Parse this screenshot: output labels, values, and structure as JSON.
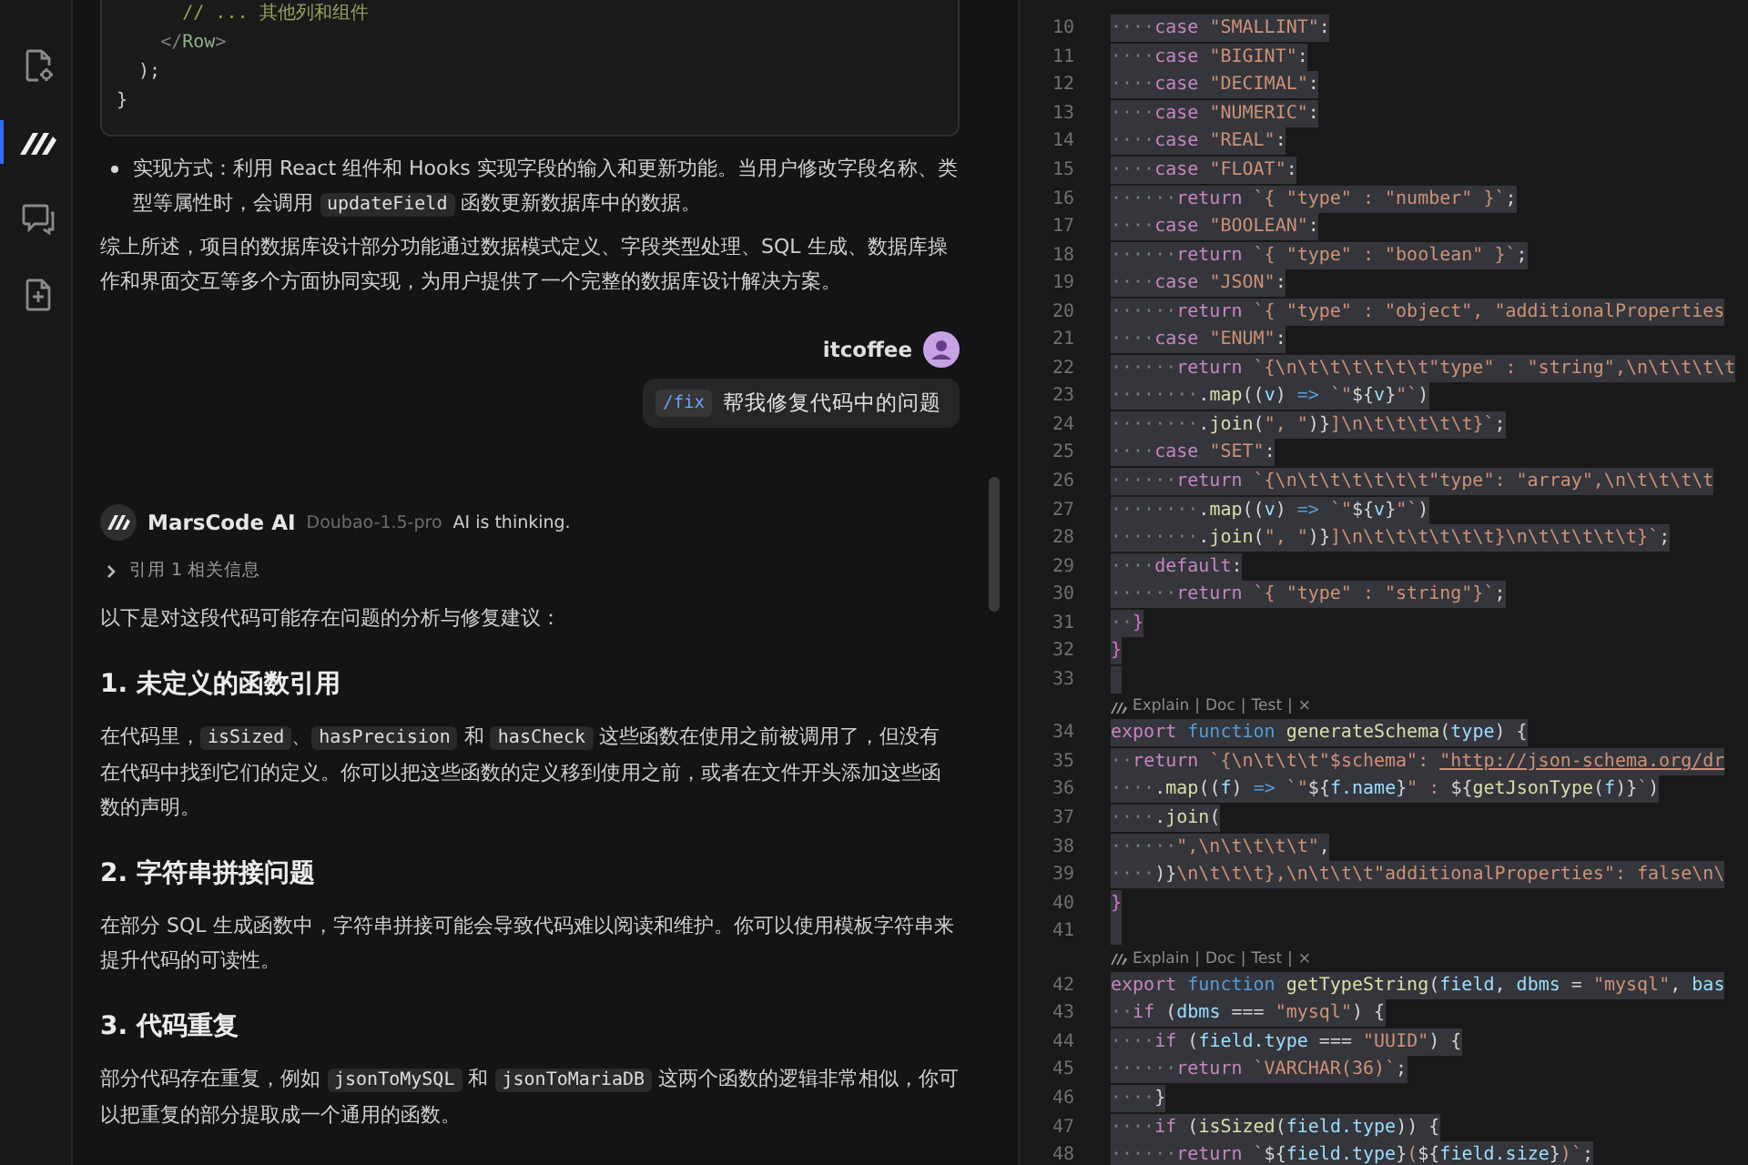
{
  "activity_bar": {
    "items": [
      {
        "kind": "file-settings",
        "selected": false
      },
      {
        "kind": "logo",
        "selected": true
      },
      {
        "kind": "chat",
        "selected": false
      },
      {
        "kind": "file-plus",
        "selected": false
      }
    ]
  },
  "chat": {
    "blocks": [
      {
        "kind": "code",
        "lines": [
          [
            {
              "kind": "comment",
              "text": "      // ... 其他列和组件"
            }
          ],
          [
            {
              "kind": "punct",
              "text": "    </"
            },
            {
              "kind": "tag",
              "text": "Row"
            },
            {
              "kind": "punct",
              "text": ">"
            }
          ],
          [
            {
              "kind": "plain",
              "text": "  );"
            }
          ],
          [
            {
              "kind": "plain",
              "text": "}"
            }
          ]
        ]
      },
      {
        "kind": "bullet",
        "segments": [
          {
            "kind": "text",
            "text": "实现方式：利用 React 组件和 Hooks 实现字段的输入和更新功能。当用户修改字段名称、类型等属性时，会调用 "
          },
          {
            "kind": "code",
            "text": "updateField"
          },
          {
            "kind": "text",
            "text": " 函数更新数据库中的数据。"
          }
        ]
      },
      {
        "kind": "paragraph",
        "segments": [
          {
            "kind": "text",
            "text": "综上所述，项目的数据库设计部分功能通过数据模式定义、字段类型处理、SQL 生成、数据库操作和界面交互等多个方面协同实现，为用户提供了一个完整的数据库设计解决方案。"
          }
        ]
      },
      {
        "kind": "user",
        "name": "itcoffee",
        "command": "/fix",
        "text": "帮我修复代码中的问题"
      },
      {
        "kind": "ai",
        "name": "MarsCode AI",
        "model": "Doubao-1.5-pro",
        "status": "AI is thinking."
      },
      {
        "kind": "reference",
        "text": "引用 1 相关信息",
        "expanded": false
      },
      {
        "kind": "paragraph",
        "segments": [
          {
            "kind": "text",
            "text": "以下是对这段代码可能存在问题的分析与修复建议："
          }
        ]
      },
      {
        "kind": "heading",
        "text": "1. 未定义的函数引用"
      },
      {
        "kind": "paragraph",
        "segments": [
          {
            "kind": "text",
            "text": "在代码里，"
          },
          {
            "kind": "code",
            "text": "isSized"
          },
          {
            "kind": "text",
            "text": "、"
          },
          {
            "kind": "code",
            "text": "hasPrecision"
          },
          {
            "kind": "text",
            "text": " 和 "
          },
          {
            "kind": "code",
            "text": "hasCheck"
          },
          {
            "kind": "text",
            "text": " 这些函数在使用之前被调用了，但没有在代码中找到它们的定义。你可以把这些函数的定义移到使用之前，或者在文件开头添加这些函数的声明。"
          }
        ]
      },
      {
        "kind": "heading",
        "text": "2. 字符串拼接问题"
      },
      {
        "kind": "paragraph",
        "segments": [
          {
            "kind": "text",
            "text": "在部分 SQL 生成函数中，字符串拼接可能会导致代码难以阅读和维护。你可以使用模板字符串来提升代码的可读性。"
          }
        ]
      },
      {
        "kind": "heading",
        "text": "3. 代码重复"
      },
      {
        "kind": "paragraph",
        "segments": [
          {
            "kind": "text",
            "text": "部分代码存在重复，例如 "
          },
          {
            "kind": "code",
            "text": "jsonToMySQL"
          },
          {
            "kind": "text",
            "text": " 和 "
          },
          {
            "kind": "code",
            "text": "jsonToMariaDB"
          },
          {
            "kind": "text",
            "text": " 这两个函数的逻辑非常相似，你可以把重复的部分提取成一个通用的函数。"
          }
        ]
      }
    ]
  },
  "editor": {
    "selected": true,
    "items": [
      {
        "kind": "line",
        "number": "10",
        "indent": "····",
        "tokens": [
          {
            "kind": "keyword",
            "text": "case"
          },
          {
            "kind": "string",
            "text": " \"SMALLINT\""
          },
          {
            "kind": "plain",
            "text": ":"
          }
        ]
      },
      {
        "kind": "line",
        "number": "11",
        "indent": "····",
        "tokens": [
          {
            "kind": "keyword",
            "text": "case"
          },
          {
            "kind": "string",
            "text": " \"BIGINT\""
          },
          {
            "kind": "plain",
            "text": ":"
          }
        ]
      },
      {
        "kind": "line",
        "number": "12",
        "indent": "····",
        "tokens": [
          {
            "kind": "keyword",
            "text": "case"
          },
          {
            "kind": "string",
            "text": " \"DECIMAL\""
          },
          {
            "kind": "plain",
            "text": ":"
          }
        ]
      },
      {
        "kind": "line",
        "number": "13",
        "indent": "····",
        "tokens": [
          {
            "kind": "keyword",
            "text": "case"
          },
          {
            "kind": "string",
            "text": " \"NUMERIC\""
          },
          {
            "kind": "plain",
            "text": ":"
          }
        ]
      },
      {
        "kind": "line",
        "number": "14",
        "indent": "····",
        "tokens": [
          {
            "kind": "keyword",
            "text": "case"
          },
          {
            "kind": "string",
            "text": " \"REAL\""
          },
          {
            "kind": "plain",
            "text": ":"
          }
        ]
      },
      {
        "kind": "line",
        "number": "15",
        "indent": "····",
        "tokens": [
          {
            "kind": "keyword",
            "text": "case"
          },
          {
            "kind": "string",
            "text": " \"FLOAT\""
          },
          {
            "kind": "plain",
            "text": ":"
          }
        ]
      },
      {
        "kind": "line",
        "number": "16",
        "indent": "······",
        "tokens": [
          {
            "kind": "keyword",
            "text": "return"
          },
          {
            "kind": "string",
            "text": " `{ \"type\" : \"number\" }`"
          },
          {
            "kind": "plain",
            "text": ";"
          }
        ]
      },
      {
        "kind": "line",
        "number": "17",
        "indent": "····",
        "tokens": [
          {
            "kind": "keyword",
            "text": "case"
          },
          {
            "kind": "string",
            "text": " \"BOOLEAN\""
          },
          {
            "kind": "plain",
            "text": ":"
          }
        ]
      },
      {
        "kind": "line",
        "number": "18",
        "indent": "······",
        "tokens": [
          {
            "kind": "keyword",
            "text": "return"
          },
          {
            "kind": "string",
            "text": " `{ \"type\" : \"boolean\" }`"
          },
          {
            "kind": "plain",
            "text": ";"
          }
        ]
      },
      {
        "kind": "line",
        "number": "19",
        "indent": "····",
        "tokens": [
          {
            "kind": "keyword",
            "text": "case"
          },
          {
            "kind": "string",
            "text": " \"JSON\""
          },
          {
            "kind": "plain",
            "text": ":"
          }
        ]
      },
      {
        "kind": "line",
        "number": "20",
        "indent": "······",
        "tokens": [
          {
            "kind": "keyword",
            "text": "return"
          },
          {
            "kind": "string",
            "text": " `{ \"type\" : \"object\", \"additionalProperties"
          }
        ]
      },
      {
        "kind": "line",
        "number": "21",
        "indent": "····",
        "tokens": [
          {
            "kind": "keyword",
            "text": "case"
          },
          {
            "kind": "string",
            "text": " \"ENUM\""
          },
          {
            "kind": "plain",
            "text": ":"
          }
        ]
      },
      {
        "kind": "line",
        "number": "22",
        "indent": "······",
        "tokens": [
          {
            "kind": "keyword",
            "text": "return"
          },
          {
            "kind": "string",
            "text": " `{\\n\\t\\t\\t\\t\\t\\t\"type\" : \"string\",\\n\\t\\t\\t\\t"
          }
        ]
      },
      {
        "kind": "line",
        "number": "23",
        "indent": "········",
        "tokens": [
          {
            "kind": "plain",
            "text": "."
          },
          {
            "kind": "function",
            "text": "map"
          },
          {
            "kind": "plain",
            "text": "(("
          },
          {
            "kind": "variable",
            "text": "v"
          },
          {
            "kind": "plain",
            "text": ") "
          },
          {
            "kind": "storage",
            "text": "=>"
          },
          {
            "kind": "string",
            "text": " `\""
          },
          {
            "kind": "plain",
            "text": "${"
          },
          {
            "kind": "variable",
            "text": "v"
          },
          {
            "kind": "plain",
            "text": "}"
          },
          {
            "kind": "string",
            "text": "\"`"
          },
          {
            "kind": "plain",
            "text": ")"
          }
        ]
      },
      {
        "kind": "line",
        "number": "24",
        "indent": "········",
        "tokens": [
          {
            "kind": "plain",
            "text": "."
          },
          {
            "kind": "function",
            "text": "join"
          },
          {
            "kind": "plain",
            "text": "("
          },
          {
            "kind": "string",
            "text": "\", \""
          },
          {
            "kind": "plain",
            "text": ")}"
          },
          {
            "kind": "string",
            "text": "]\\n\\t\\t\\t\\t\\t}`"
          },
          {
            "kind": "plain",
            "text": ";"
          }
        ]
      },
      {
        "kind": "line",
        "number": "25",
        "indent": "····",
        "tokens": [
          {
            "kind": "keyword",
            "text": "case"
          },
          {
            "kind": "string",
            "text": " \"SET\""
          },
          {
            "kind": "plain",
            "text": ":"
          }
        ]
      },
      {
        "kind": "line",
        "number": "26",
        "indent": "······",
        "tokens": [
          {
            "kind": "keyword",
            "text": "return"
          },
          {
            "kind": "string",
            "text": " `{\\n\\t\\t\\t\\t\\t\\t\"type\": \"array\",\\n\\t\\t\\t\\t"
          }
        ]
      },
      {
        "kind": "line",
        "number": "27",
        "indent": "········",
        "tokens": [
          {
            "kind": "plain",
            "text": "."
          },
          {
            "kind": "function",
            "text": "map"
          },
          {
            "kind": "plain",
            "text": "(("
          },
          {
            "kind": "variable",
            "text": "v"
          },
          {
            "kind": "plain",
            "text": ") "
          },
          {
            "kind": "storage",
            "text": "=>"
          },
          {
            "kind": "string",
            "text": " `\""
          },
          {
            "kind": "plain",
            "text": "${"
          },
          {
            "kind": "variable",
            "text": "v"
          },
          {
            "kind": "plain",
            "text": "}"
          },
          {
            "kind": "string",
            "text": "\"`"
          },
          {
            "kind": "plain",
            "text": ")"
          }
        ]
      },
      {
        "kind": "line",
        "number": "28",
        "indent": "········",
        "tokens": [
          {
            "kind": "plain",
            "text": "."
          },
          {
            "kind": "function",
            "text": "join"
          },
          {
            "kind": "plain",
            "text": "("
          },
          {
            "kind": "string",
            "text": "\", \""
          },
          {
            "kind": "plain",
            "text": ")}"
          },
          {
            "kind": "string",
            "text": "]\\n\\t\\t\\t\\t\\t\\t}\\n\\t\\t\\t\\t\\t}`"
          },
          {
            "kind": "plain",
            "text": ";"
          }
        ]
      },
      {
        "kind": "line",
        "number": "29",
        "indent": "····",
        "tokens": [
          {
            "kind": "keyword",
            "text": "default"
          },
          {
            "kind": "plain",
            "text": ":"
          }
        ]
      },
      {
        "kind": "line",
        "number": "30",
        "indent": "······",
        "tokens": [
          {
            "kind": "keyword",
            "text": "return"
          },
          {
            "kind": "string",
            "text": " `{ \"type\" : \"string\"}`"
          },
          {
            "kind": "plain",
            "text": ";"
          }
        ]
      },
      {
        "kind": "line",
        "number": "31",
        "indent": "··",
        "tokens": [
          {
            "kind": "bracket",
            "text": "}"
          }
        ]
      },
      {
        "kind": "line",
        "number": "32",
        "tokens": [
          {
            "kind": "bracket",
            "text": "}"
          }
        ]
      },
      {
        "kind": "line",
        "number": "33"
      },
      {
        "kind": "codelens",
        "actions": [
          "Explain",
          "Doc",
          "Test",
          "×"
        ],
        "separator": "|"
      },
      {
        "kind": "line",
        "number": "34",
        "tokens": [
          {
            "kind": "keyword",
            "text": "export"
          },
          {
            "kind": "storage",
            "text": " function"
          },
          {
            "kind": "function",
            "text": " generateSchema"
          },
          {
            "kind": "plain",
            "text": "("
          },
          {
            "kind": "variable",
            "text": "type"
          },
          {
            "kind": "plain",
            "text": ") {"
          }
        ]
      },
      {
        "kind": "line",
        "number": "35",
        "indent": "··",
        "tokens": [
          {
            "kind": "keyword",
            "text": "return"
          },
          {
            "kind": "string",
            "text": " `{\\n\\t\\t\\t\"$schema\": "
          },
          {
            "kind": "link",
            "text": "\"http://json-schema.org/dr"
          }
        ]
      },
      {
        "kind": "line",
        "number": "36",
        "indent": "····",
        "tokens": [
          {
            "kind": "plain",
            "text": "."
          },
          {
            "kind": "function",
            "text": "map"
          },
          {
            "kind": "plain",
            "text": "(("
          },
          {
            "kind": "variable",
            "text": "f"
          },
          {
            "kind": "plain",
            "text": ") "
          },
          {
            "kind": "storage",
            "text": "=>"
          },
          {
            "kind": "string",
            "text": " `\""
          },
          {
            "kind": "plain",
            "text": "${"
          },
          {
            "kind": "variable",
            "text": "f.name"
          },
          {
            "kind": "plain",
            "text": "}"
          },
          {
            "kind": "string",
            "text": "\" : "
          },
          {
            "kind": "plain",
            "text": "${"
          },
          {
            "kind": "function",
            "text": "getJsonType"
          },
          {
            "kind": "plain",
            "text": "("
          },
          {
            "kind": "variable",
            "text": "f"
          },
          {
            "kind": "plain",
            "text": ")}"
          },
          {
            "kind": "string",
            "text": "`"
          },
          {
            "kind": "plain",
            "text": ")"
          }
        ]
      },
      {
        "kind": "line",
        "number": "37",
        "indent": "····",
        "tokens": [
          {
            "kind": "plain",
            "text": "."
          },
          {
            "kind": "function",
            "text": "join"
          },
          {
            "kind": "plain",
            "text": "("
          }
        ]
      },
      {
        "kind": "line",
        "number": "38",
        "indent": "······",
        "tokens": [
          {
            "kind": "string",
            "text": "\",\\n\\t\\t\\t\\t\""
          },
          {
            "kind": "plain",
            "text": ","
          }
        ]
      },
      {
        "kind": "line",
        "number": "39",
        "indent": "····",
        "tokens": [
          {
            "kind": "plain",
            "text": ")}"
          },
          {
            "kind": "string",
            "text": "\\n\\t\\t\\t},\\n\\t\\t\\t\"additionalProperties\": false\\n\\"
          }
        ]
      },
      {
        "kind": "line",
        "number": "40",
        "tokens": [
          {
            "kind": "bracket",
            "text": "}"
          }
        ]
      },
      {
        "kind": "line",
        "number": "41"
      },
      {
        "kind": "codelens",
        "actions": [
          "Explain",
          "Doc",
          "Test",
          "×"
        ],
        "separator": "|"
      },
      {
        "kind": "line",
        "number": "42",
        "tokens": [
          {
            "kind": "keyword",
            "text": "export"
          },
          {
            "kind": "storage",
            "text": " function"
          },
          {
            "kind": "function",
            "text": " getTypeString"
          },
          {
            "kind": "plain",
            "text": "("
          },
          {
            "kind": "variable",
            "text": "field"
          },
          {
            "kind": "plain",
            "text": ", "
          },
          {
            "kind": "variable",
            "text": "dbms"
          },
          {
            "kind": "plain",
            "text": " = "
          },
          {
            "kind": "string",
            "text": "\"mysql\""
          },
          {
            "kind": "plain",
            "text": ", "
          },
          {
            "kind": "variable",
            "text": "bas"
          }
        ]
      },
      {
        "kind": "line",
        "number": "43",
        "indent": "··",
        "tokens": [
          {
            "kind": "keyword",
            "text": "if"
          },
          {
            "kind": "plain",
            "text": " ("
          },
          {
            "kind": "variable",
            "text": "dbms"
          },
          {
            "kind": "plain",
            "text": " === "
          },
          {
            "kind": "string",
            "text": "\"mysql\""
          },
          {
            "kind": "plain",
            "text": ") {"
          }
        ]
      },
      {
        "kind": "line",
        "number": "44",
        "indent": "····",
        "tokens": [
          {
            "kind": "keyword",
            "text": "if"
          },
          {
            "kind": "plain",
            "text": " ("
          },
          {
            "kind": "variable",
            "text": "field.type"
          },
          {
            "kind": "plain",
            "text": " === "
          },
          {
            "kind": "string",
            "text": "\"UUID\""
          },
          {
            "kind": "plain",
            "text": ") {"
          }
        ]
      },
      {
        "kind": "line",
        "number": "45",
        "indent": "······",
        "tokens": [
          {
            "kind": "keyword",
            "text": "return"
          },
          {
            "kind": "string",
            "text": " `VARCHAR(36)`"
          },
          {
            "kind": "plain",
            "text": ";"
          }
        ]
      },
      {
        "kind": "line",
        "number": "46",
        "indent": "····",
        "tokens": [
          {
            "kind": "plain",
            "text": "}"
          }
        ]
      },
      {
        "kind": "line",
        "number": "47",
        "indent": "····",
        "tokens": [
          {
            "kind": "keyword",
            "text": "if"
          },
          {
            "kind": "plain",
            "text": " ("
          },
          {
            "kind": "function",
            "text": "isSized"
          },
          {
            "kind": "plain",
            "text": "("
          },
          {
            "kind": "variable",
            "text": "field.type"
          },
          {
            "kind": "plain",
            "text": ")) {"
          }
        ]
      },
      {
        "kind": "line",
        "number": "48",
        "indent": "······",
        "tokens": [
          {
            "kind": "keyword",
            "text": "return"
          },
          {
            "kind": "string",
            "text": " `"
          },
          {
            "kind": "plain",
            "text": "${"
          },
          {
            "kind": "variable",
            "text": "field.type"
          },
          {
            "kind": "plain",
            "text": "}"
          },
          {
            "kind": "string",
            "text": "("
          },
          {
            "kind": "plain",
            "text": "${"
          },
          {
            "kind": "variable",
            "text": "field.size"
          },
          {
            "kind": "plain",
            "text": "}"
          },
          {
            "kind": "string",
            "text": ")`"
          },
          {
            "kind": "plain",
            "text": ";"
          }
        ]
      }
    ]
  }
}
